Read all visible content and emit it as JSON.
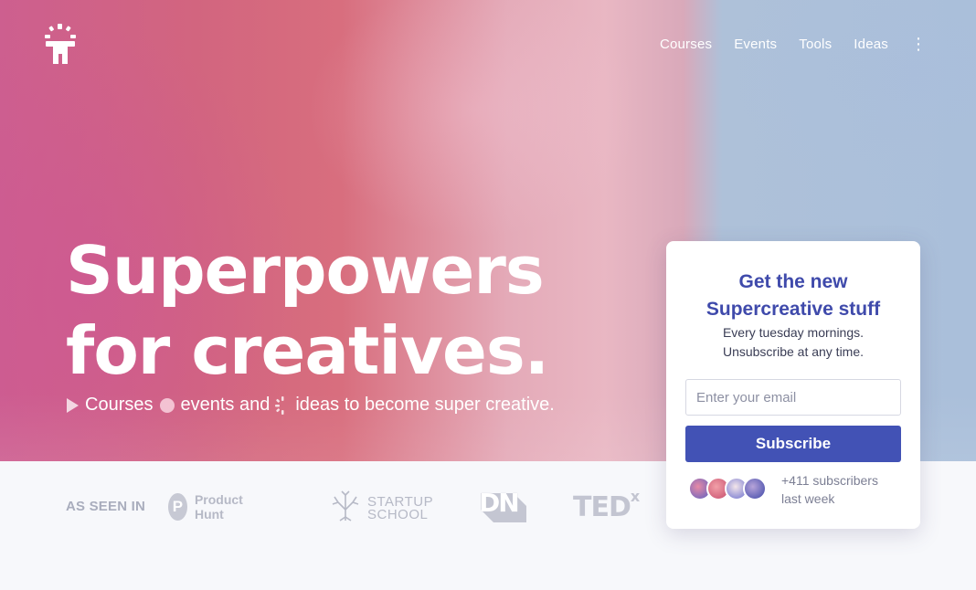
{
  "nav": {
    "items": [
      {
        "label": "Courses"
      },
      {
        "label": "Events"
      },
      {
        "label": "Tools"
      },
      {
        "label": "Ideas"
      }
    ],
    "more_icon": "⋮"
  },
  "hero": {
    "headline_line1": "Superpowers",
    "headline_line2": "for creatives.",
    "sub_courses": "Courses",
    "sub_events": "events and",
    "sub_ideas": "ideas to become super creative."
  },
  "press": {
    "label": "AS SEEN IN",
    "product_hunt_letter": "P",
    "product_hunt": "Product Hunt",
    "startup_school_line1": "STARTUP",
    "startup_school_line2": "SCHOOL",
    "dn": "DN",
    "tedx": "TED",
    "tedx_sup": "x"
  },
  "signup": {
    "title_line1": "Get the new",
    "title_line2": "Supercreative stuff",
    "sub_line1": "Every tuesday mornings.",
    "sub_line2": "Unsubscribe at any time.",
    "email_placeholder": "Enter your email",
    "button_label": "Subscribe",
    "subscribers_line1": "+411 subscribers",
    "subscribers_line2": "last week"
  },
  "colors": {
    "accent": "#4252b5",
    "title": "#3f4aab"
  }
}
